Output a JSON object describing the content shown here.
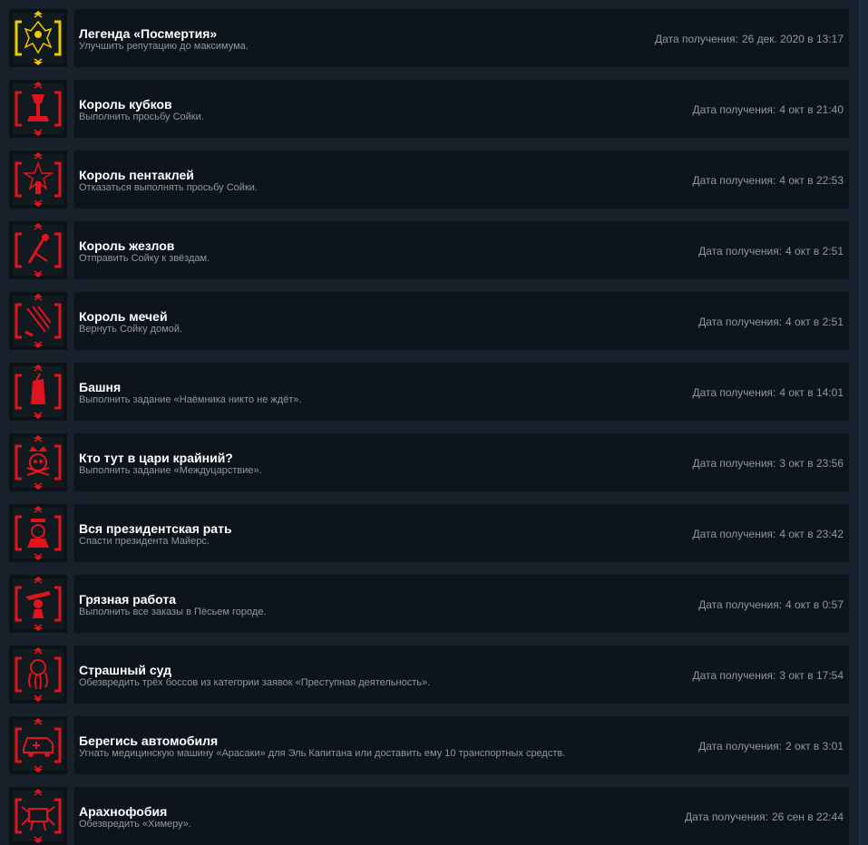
{
  "date_label": "Дата получения:",
  "achievements": [
    {
      "title": "Легенда «Посмертия»",
      "description": "Улучшить репутацию до максимума.",
      "date": "26 дек. 2020 в 13:17",
      "icon": "legend-icon",
      "accent": "#f0c800"
    },
    {
      "title": "Король кубков",
      "description": "Выполнить просьбу Сойки.",
      "date": "4 окт в 21:40",
      "icon": "cups-icon",
      "accent": "#e0141e"
    },
    {
      "title": "Король пентаклей",
      "description": "Отказаться выполнять просьбу Сойки.",
      "date": "4 окт в 22:53",
      "icon": "pentacles-icon",
      "accent": "#e0141e"
    },
    {
      "title": "Король жезлов",
      "description": "Отправить Сойку к звёздам.",
      "date": "4 окт в 2:51",
      "icon": "wands-icon",
      "accent": "#e0141e"
    },
    {
      "title": "Король мечей",
      "description": "Вернуть Сойку домой.",
      "date": "4 окт в 2:51",
      "icon": "swords-icon",
      "accent": "#e0141e"
    },
    {
      "title": "Башня",
      "description": "Выполнить задание «Наёмника никто не ждёт».",
      "date": "4 окт в 14:01",
      "icon": "tower-icon",
      "accent": "#e0141e"
    },
    {
      "title": "Кто тут в цари крайний?",
      "description": "Выполнить задание «Междуцарствие».",
      "date": "3 окт в 23:56",
      "icon": "crown-skull-icon",
      "accent": "#e0141e"
    },
    {
      "title": "Вся президентская рать",
      "description": "Спасти президента Майерс.",
      "date": "4 окт в 23:42",
      "icon": "president-icon",
      "accent": "#e0141e"
    },
    {
      "title": "Грязная работа",
      "description": "Выполнить все заказы в Пёсьем городе.",
      "date": "4 окт в 0:57",
      "icon": "gunman-icon",
      "accent": "#e0141e"
    },
    {
      "title": "Страшный суд",
      "description": "Обезвредить трёх боссов из категории заявок «Преступная деятельность».",
      "date": "3 окт в 17:54",
      "icon": "octopus-icon",
      "accent": "#e0141e"
    },
    {
      "title": "Берегись автомобиля",
      "description": "Угнать медицинскую машину «Арасаки» для Эль Капитана или доставить ему 10 транспортных средств.",
      "date": "2 окт в 3:01",
      "icon": "ambulance-icon",
      "accent": "#e0141e"
    },
    {
      "title": "Арахнофобия",
      "description": "Обезвредить «Химеру».",
      "date": "26 сен в 22:44",
      "icon": "spider-tank-icon",
      "accent": "#e0141e"
    }
  ]
}
